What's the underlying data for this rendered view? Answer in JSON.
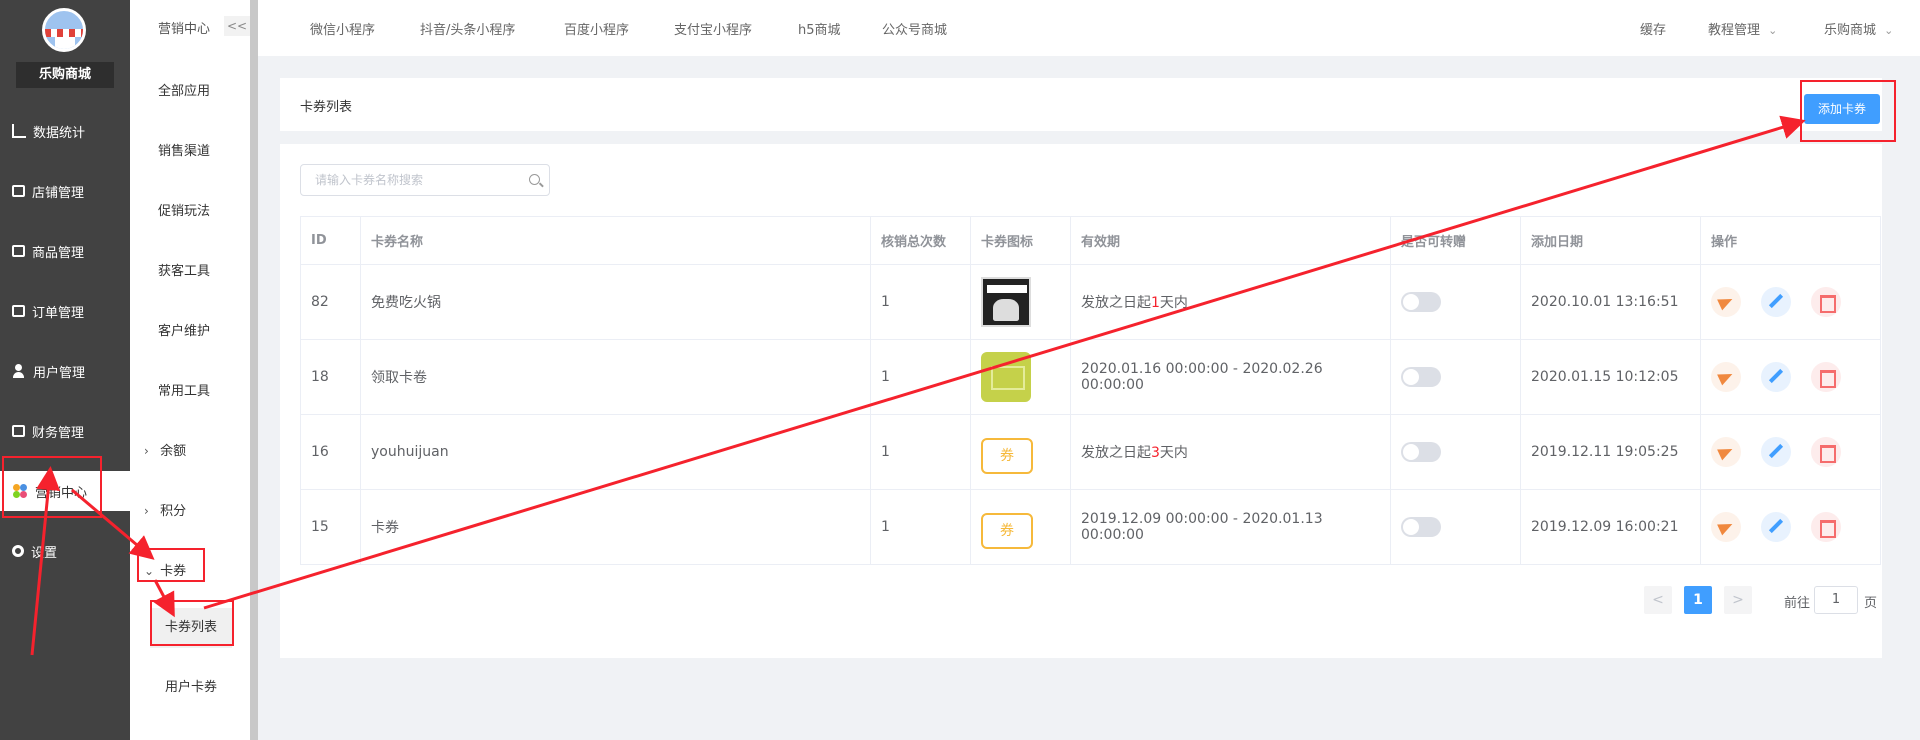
{
  "app": {
    "shop_name": "乐购商城"
  },
  "sidebar": {
    "items": [
      {
        "label": "数据统计",
        "icon": "line-chart-icon"
      },
      {
        "label": "店铺管理",
        "icon": "store-icon"
      },
      {
        "label": "商品管理",
        "icon": "goods-icon"
      },
      {
        "label": "订单管理",
        "icon": "order-icon"
      },
      {
        "label": "用户管理",
        "icon": "user-icon"
      },
      {
        "label": "财务管理",
        "icon": "finance-icon"
      },
      {
        "label": "营销中心",
        "icon": "marketing-icon",
        "active": true
      },
      {
        "label": "设置",
        "icon": "gear-icon"
      }
    ]
  },
  "submenu": {
    "title": "营销中心",
    "collapse_label": "<<",
    "items": [
      "全部应用",
      "销售渠道",
      "促销玩法",
      "获客工具",
      "客户维护",
      "常用工具"
    ],
    "groups": [
      {
        "label": "余额",
        "expanded": false
      },
      {
        "label": "积分",
        "expanded": false
      },
      {
        "label": "卡券",
        "expanded": true,
        "children": [
          "卡券列表",
          "用户卡券"
        ]
      }
    ]
  },
  "topbar": {
    "tabs": [
      "微信小程序",
      "抖音/头条小程序",
      "百度小程序",
      "支付宝小程序",
      "h5商城",
      "公众号商城"
    ],
    "right": [
      {
        "label": "缓存"
      },
      {
        "label": "教程管理",
        "dropdown": true
      },
      {
        "label": "乐购商城",
        "dropdown": true
      }
    ]
  },
  "page": {
    "title": "卡券列表",
    "add_button": "添加卡券",
    "search_placeholder": "请输入卡券名称搜索"
  },
  "table": {
    "columns": [
      "ID",
      "卡券名称",
      "核销总次数",
      "卡券图标",
      "有效期",
      "是否可转赠",
      "添加日期",
      "操作"
    ],
    "rows": [
      {
        "id": "82",
        "name": "免费吃火锅",
        "count": "1",
        "icon": "poster-image",
        "validity_pre": "发放之日起",
        "validity_num": "1",
        "validity_post": "天内",
        "transfer": false,
        "date": "2020.10.01 13:16:51"
      },
      {
        "id": "18",
        "name": "领取卡卷",
        "count": "1",
        "icon": "green-ticket-image",
        "validity_range": "2020.01.16 00:00:00 - 2020.02.26 00:00:00",
        "transfer": false,
        "date": "2020.01.15 10:12:05"
      },
      {
        "id": "16",
        "name": "youhuijuan",
        "count": "1",
        "icon": "yellow-ticket-icon",
        "icon_text": "券",
        "validity_pre": "发放之日起",
        "validity_num": "3",
        "validity_post": "天内",
        "transfer": false,
        "date": "2019.12.11 19:05:25"
      },
      {
        "id": "15",
        "name": "卡券",
        "count": "1",
        "icon": "yellow-ticket-icon",
        "icon_text": "券",
        "validity_range": "2019.12.09 00:00:00 - 2020.01.13 00:00:00",
        "transfer": false,
        "date": "2019.12.09 16:00:21"
      }
    ]
  },
  "pagination": {
    "prev": "<",
    "current": "1",
    "next": ">",
    "goto_label": "前往",
    "goto_value": "1",
    "page_unit": "页"
  },
  "colors": {
    "accent": "#409eff",
    "sidebar_bg": "#424242",
    "highlight_red": "#f5222d",
    "annotation": "#f5222d"
  }
}
